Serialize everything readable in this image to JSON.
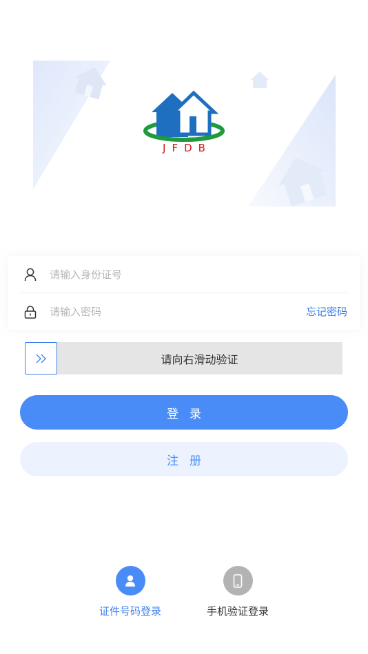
{
  "brand": {
    "logo_text": "JFDB"
  },
  "form": {
    "id_placeholder": "请输入身份证号",
    "password_placeholder": "请输入密码",
    "forgot_password": "忘记密码"
  },
  "slider": {
    "hint": "请向右滑动验证"
  },
  "buttons": {
    "login": "登录",
    "register": "注册"
  },
  "login_modes": [
    {
      "label": "证件号码登录",
      "icon": "user-icon",
      "active": true
    },
    {
      "label": "手机验证登录",
      "icon": "phone-icon",
      "active": false
    }
  ],
  "colors": {
    "primary": "#4a8cf7",
    "link": "#3a7ee8",
    "register_bg": "#ecf3fe",
    "slider_bg": "#e5e5e5",
    "inactive_icon": "#b3b3b3",
    "logo_blue": "#1f6fc0",
    "logo_green": "#1f9a3d",
    "logo_red": "#d0181c"
  }
}
